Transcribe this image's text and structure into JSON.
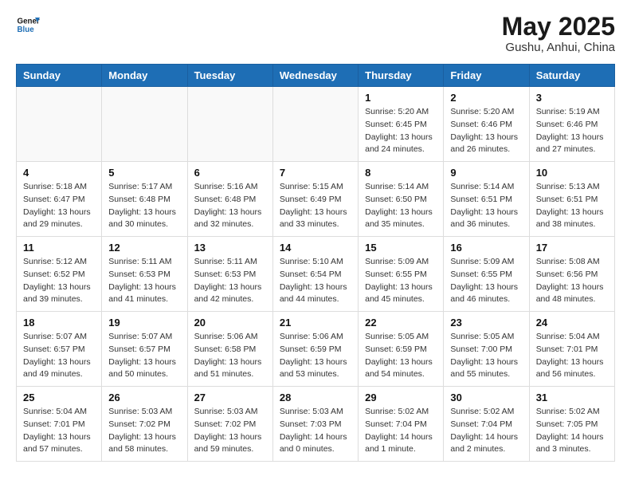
{
  "header": {
    "logo_general": "General",
    "logo_blue": "Blue",
    "month_title": "May 2025",
    "location": "Gushu, Anhui, China"
  },
  "days_of_week": [
    "Sunday",
    "Monday",
    "Tuesday",
    "Wednesday",
    "Thursday",
    "Friday",
    "Saturday"
  ],
  "weeks": [
    [
      {
        "day": "",
        "info": ""
      },
      {
        "day": "",
        "info": ""
      },
      {
        "day": "",
        "info": ""
      },
      {
        "day": "",
        "info": ""
      },
      {
        "day": "1",
        "info": "Sunrise: 5:20 AM\nSunset: 6:45 PM\nDaylight: 13 hours\nand 24 minutes."
      },
      {
        "day": "2",
        "info": "Sunrise: 5:20 AM\nSunset: 6:46 PM\nDaylight: 13 hours\nand 26 minutes."
      },
      {
        "day": "3",
        "info": "Sunrise: 5:19 AM\nSunset: 6:46 PM\nDaylight: 13 hours\nand 27 minutes."
      }
    ],
    [
      {
        "day": "4",
        "info": "Sunrise: 5:18 AM\nSunset: 6:47 PM\nDaylight: 13 hours\nand 29 minutes."
      },
      {
        "day": "5",
        "info": "Sunrise: 5:17 AM\nSunset: 6:48 PM\nDaylight: 13 hours\nand 30 minutes."
      },
      {
        "day": "6",
        "info": "Sunrise: 5:16 AM\nSunset: 6:48 PM\nDaylight: 13 hours\nand 32 minutes."
      },
      {
        "day": "7",
        "info": "Sunrise: 5:15 AM\nSunset: 6:49 PM\nDaylight: 13 hours\nand 33 minutes."
      },
      {
        "day": "8",
        "info": "Sunrise: 5:14 AM\nSunset: 6:50 PM\nDaylight: 13 hours\nand 35 minutes."
      },
      {
        "day": "9",
        "info": "Sunrise: 5:14 AM\nSunset: 6:51 PM\nDaylight: 13 hours\nand 36 minutes."
      },
      {
        "day": "10",
        "info": "Sunrise: 5:13 AM\nSunset: 6:51 PM\nDaylight: 13 hours\nand 38 minutes."
      }
    ],
    [
      {
        "day": "11",
        "info": "Sunrise: 5:12 AM\nSunset: 6:52 PM\nDaylight: 13 hours\nand 39 minutes."
      },
      {
        "day": "12",
        "info": "Sunrise: 5:11 AM\nSunset: 6:53 PM\nDaylight: 13 hours\nand 41 minutes."
      },
      {
        "day": "13",
        "info": "Sunrise: 5:11 AM\nSunset: 6:53 PM\nDaylight: 13 hours\nand 42 minutes."
      },
      {
        "day": "14",
        "info": "Sunrise: 5:10 AM\nSunset: 6:54 PM\nDaylight: 13 hours\nand 44 minutes."
      },
      {
        "day": "15",
        "info": "Sunrise: 5:09 AM\nSunset: 6:55 PM\nDaylight: 13 hours\nand 45 minutes."
      },
      {
        "day": "16",
        "info": "Sunrise: 5:09 AM\nSunset: 6:55 PM\nDaylight: 13 hours\nand 46 minutes."
      },
      {
        "day": "17",
        "info": "Sunrise: 5:08 AM\nSunset: 6:56 PM\nDaylight: 13 hours\nand 48 minutes."
      }
    ],
    [
      {
        "day": "18",
        "info": "Sunrise: 5:07 AM\nSunset: 6:57 PM\nDaylight: 13 hours\nand 49 minutes."
      },
      {
        "day": "19",
        "info": "Sunrise: 5:07 AM\nSunset: 6:57 PM\nDaylight: 13 hours\nand 50 minutes."
      },
      {
        "day": "20",
        "info": "Sunrise: 5:06 AM\nSunset: 6:58 PM\nDaylight: 13 hours\nand 51 minutes."
      },
      {
        "day": "21",
        "info": "Sunrise: 5:06 AM\nSunset: 6:59 PM\nDaylight: 13 hours\nand 53 minutes."
      },
      {
        "day": "22",
        "info": "Sunrise: 5:05 AM\nSunset: 6:59 PM\nDaylight: 13 hours\nand 54 minutes."
      },
      {
        "day": "23",
        "info": "Sunrise: 5:05 AM\nSunset: 7:00 PM\nDaylight: 13 hours\nand 55 minutes."
      },
      {
        "day": "24",
        "info": "Sunrise: 5:04 AM\nSunset: 7:01 PM\nDaylight: 13 hours\nand 56 minutes."
      }
    ],
    [
      {
        "day": "25",
        "info": "Sunrise: 5:04 AM\nSunset: 7:01 PM\nDaylight: 13 hours\nand 57 minutes."
      },
      {
        "day": "26",
        "info": "Sunrise: 5:03 AM\nSunset: 7:02 PM\nDaylight: 13 hours\nand 58 minutes."
      },
      {
        "day": "27",
        "info": "Sunrise: 5:03 AM\nSunset: 7:02 PM\nDaylight: 13 hours\nand 59 minutes."
      },
      {
        "day": "28",
        "info": "Sunrise: 5:03 AM\nSunset: 7:03 PM\nDaylight: 14 hours\nand 0 minutes."
      },
      {
        "day": "29",
        "info": "Sunrise: 5:02 AM\nSunset: 7:04 PM\nDaylight: 14 hours\nand 1 minute."
      },
      {
        "day": "30",
        "info": "Sunrise: 5:02 AM\nSunset: 7:04 PM\nDaylight: 14 hours\nand 2 minutes."
      },
      {
        "day": "31",
        "info": "Sunrise: 5:02 AM\nSunset: 7:05 PM\nDaylight: 14 hours\nand 3 minutes."
      }
    ]
  ]
}
